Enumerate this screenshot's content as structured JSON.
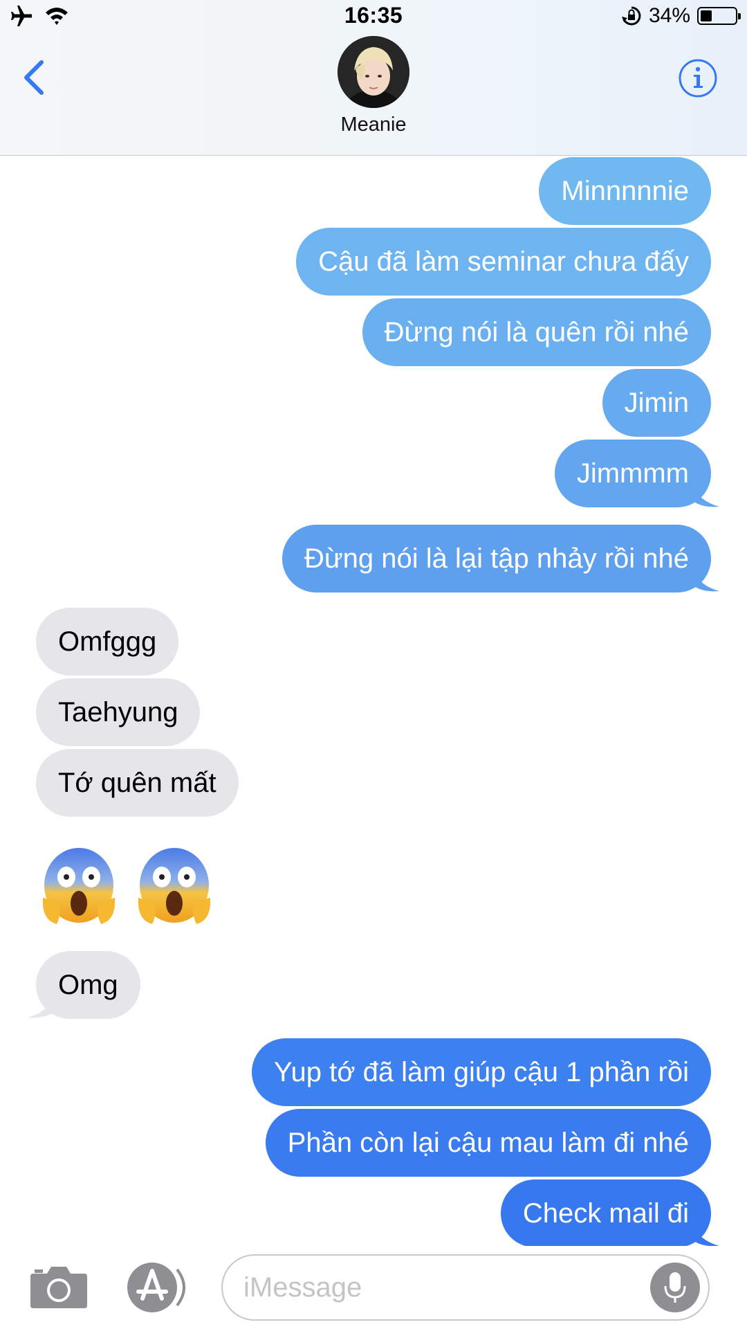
{
  "status_bar": {
    "time": "16:35",
    "battery_percent": "34%",
    "battery_level": 0.34,
    "icons": [
      "airplane-icon",
      "wifi-icon",
      "rotation-lock-icon",
      "battery-icon"
    ]
  },
  "header": {
    "contact_name": "Meanie",
    "back_icon": "chevron-left-icon",
    "info_icon": "info-icon",
    "accent_color": "#3478f6"
  },
  "messages": [
    {
      "direction": "out",
      "text": "Minnnnnie",
      "color": "#6fb8f0"
    },
    {
      "direction": "out",
      "text": "Cậu đã làm seminar chưa đấy",
      "color": "#6db4f0"
    },
    {
      "direction": "out",
      "text": "Đừng nói là quên rồi nhé",
      "color": "#6aaff0"
    },
    {
      "direction": "out",
      "text": "Jimin",
      "color": "#66aaef"
    },
    {
      "direction": "out",
      "text": "Jimmmm",
      "color": "#63a5ef"
    },
    {
      "direction": "out",
      "text": "Đừng nói là lại tập nhảy rồi nhé",
      "color": "#5e9fee"
    },
    {
      "direction": "in",
      "text": "Omfggg"
    },
    {
      "direction": "in",
      "text": "Taehyung"
    },
    {
      "direction": "in",
      "text": "Tớ quên mất"
    },
    {
      "direction": "in",
      "type": "emoji",
      "text": "😱😱"
    },
    {
      "direction": "in",
      "text": "Omg"
    },
    {
      "direction": "out",
      "text": "Yup tớ đã làm giúp cậu 1 phần rồi",
      "color": "#3d80f0"
    },
    {
      "direction": "out",
      "text": "Phần còn lại cậu mau làm đi nhé",
      "color": "#3a7cef"
    },
    {
      "direction": "out",
      "text": "Check mail đi",
      "color": "#3778ef"
    }
  ],
  "composer": {
    "placeholder": "iMessage",
    "camera_icon": "camera-icon",
    "apps_icon": "app-store-icon",
    "mic_icon": "microphone-icon"
  }
}
